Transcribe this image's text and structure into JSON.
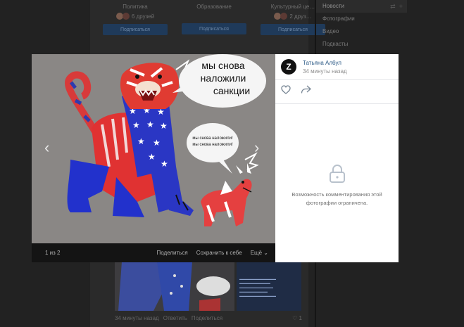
{
  "background_page": {
    "cards": [
      {
        "category": "Политика",
        "friends": "6 друзей",
        "button": "Подписаться"
      },
      {
        "category": "Образование",
        "friends": "",
        "button": "Подписаться"
      },
      {
        "category": "Культурный це…",
        "friends": "2 друз…",
        "button": "Подписаться"
      }
    ],
    "sidebar": {
      "items": [
        "Новости",
        "Фотографии",
        "Видео",
        "Подкасты"
      ]
    },
    "post": {
      "time": "34 минуты назад",
      "comment": "Ответить",
      "share": "Поделиться",
      "likes": "1"
    }
  },
  "viewer": {
    "image_text": {
      "big_bubble": [
        "мы снова",
        "наложили",
        "санкции"
      ],
      "small_bubble": [
        "мы снова наложили!",
        "мы снова наложили!"
      ]
    },
    "counter": "1 из 2",
    "actions": {
      "share": "Поделиться",
      "save": "Сохранить к себе",
      "more": "Ещё"
    },
    "author": {
      "name": "Татьяна Албул",
      "time": "34 минуты назад",
      "avatar_letter": "Z"
    },
    "comment_notice": "Возможность комментирования этой фотографии ограничена."
  },
  "colors": {
    "link": "#2a5885",
    "overlay": "#222222",
    "button_dim": "#1f3a5a"
  }
}
